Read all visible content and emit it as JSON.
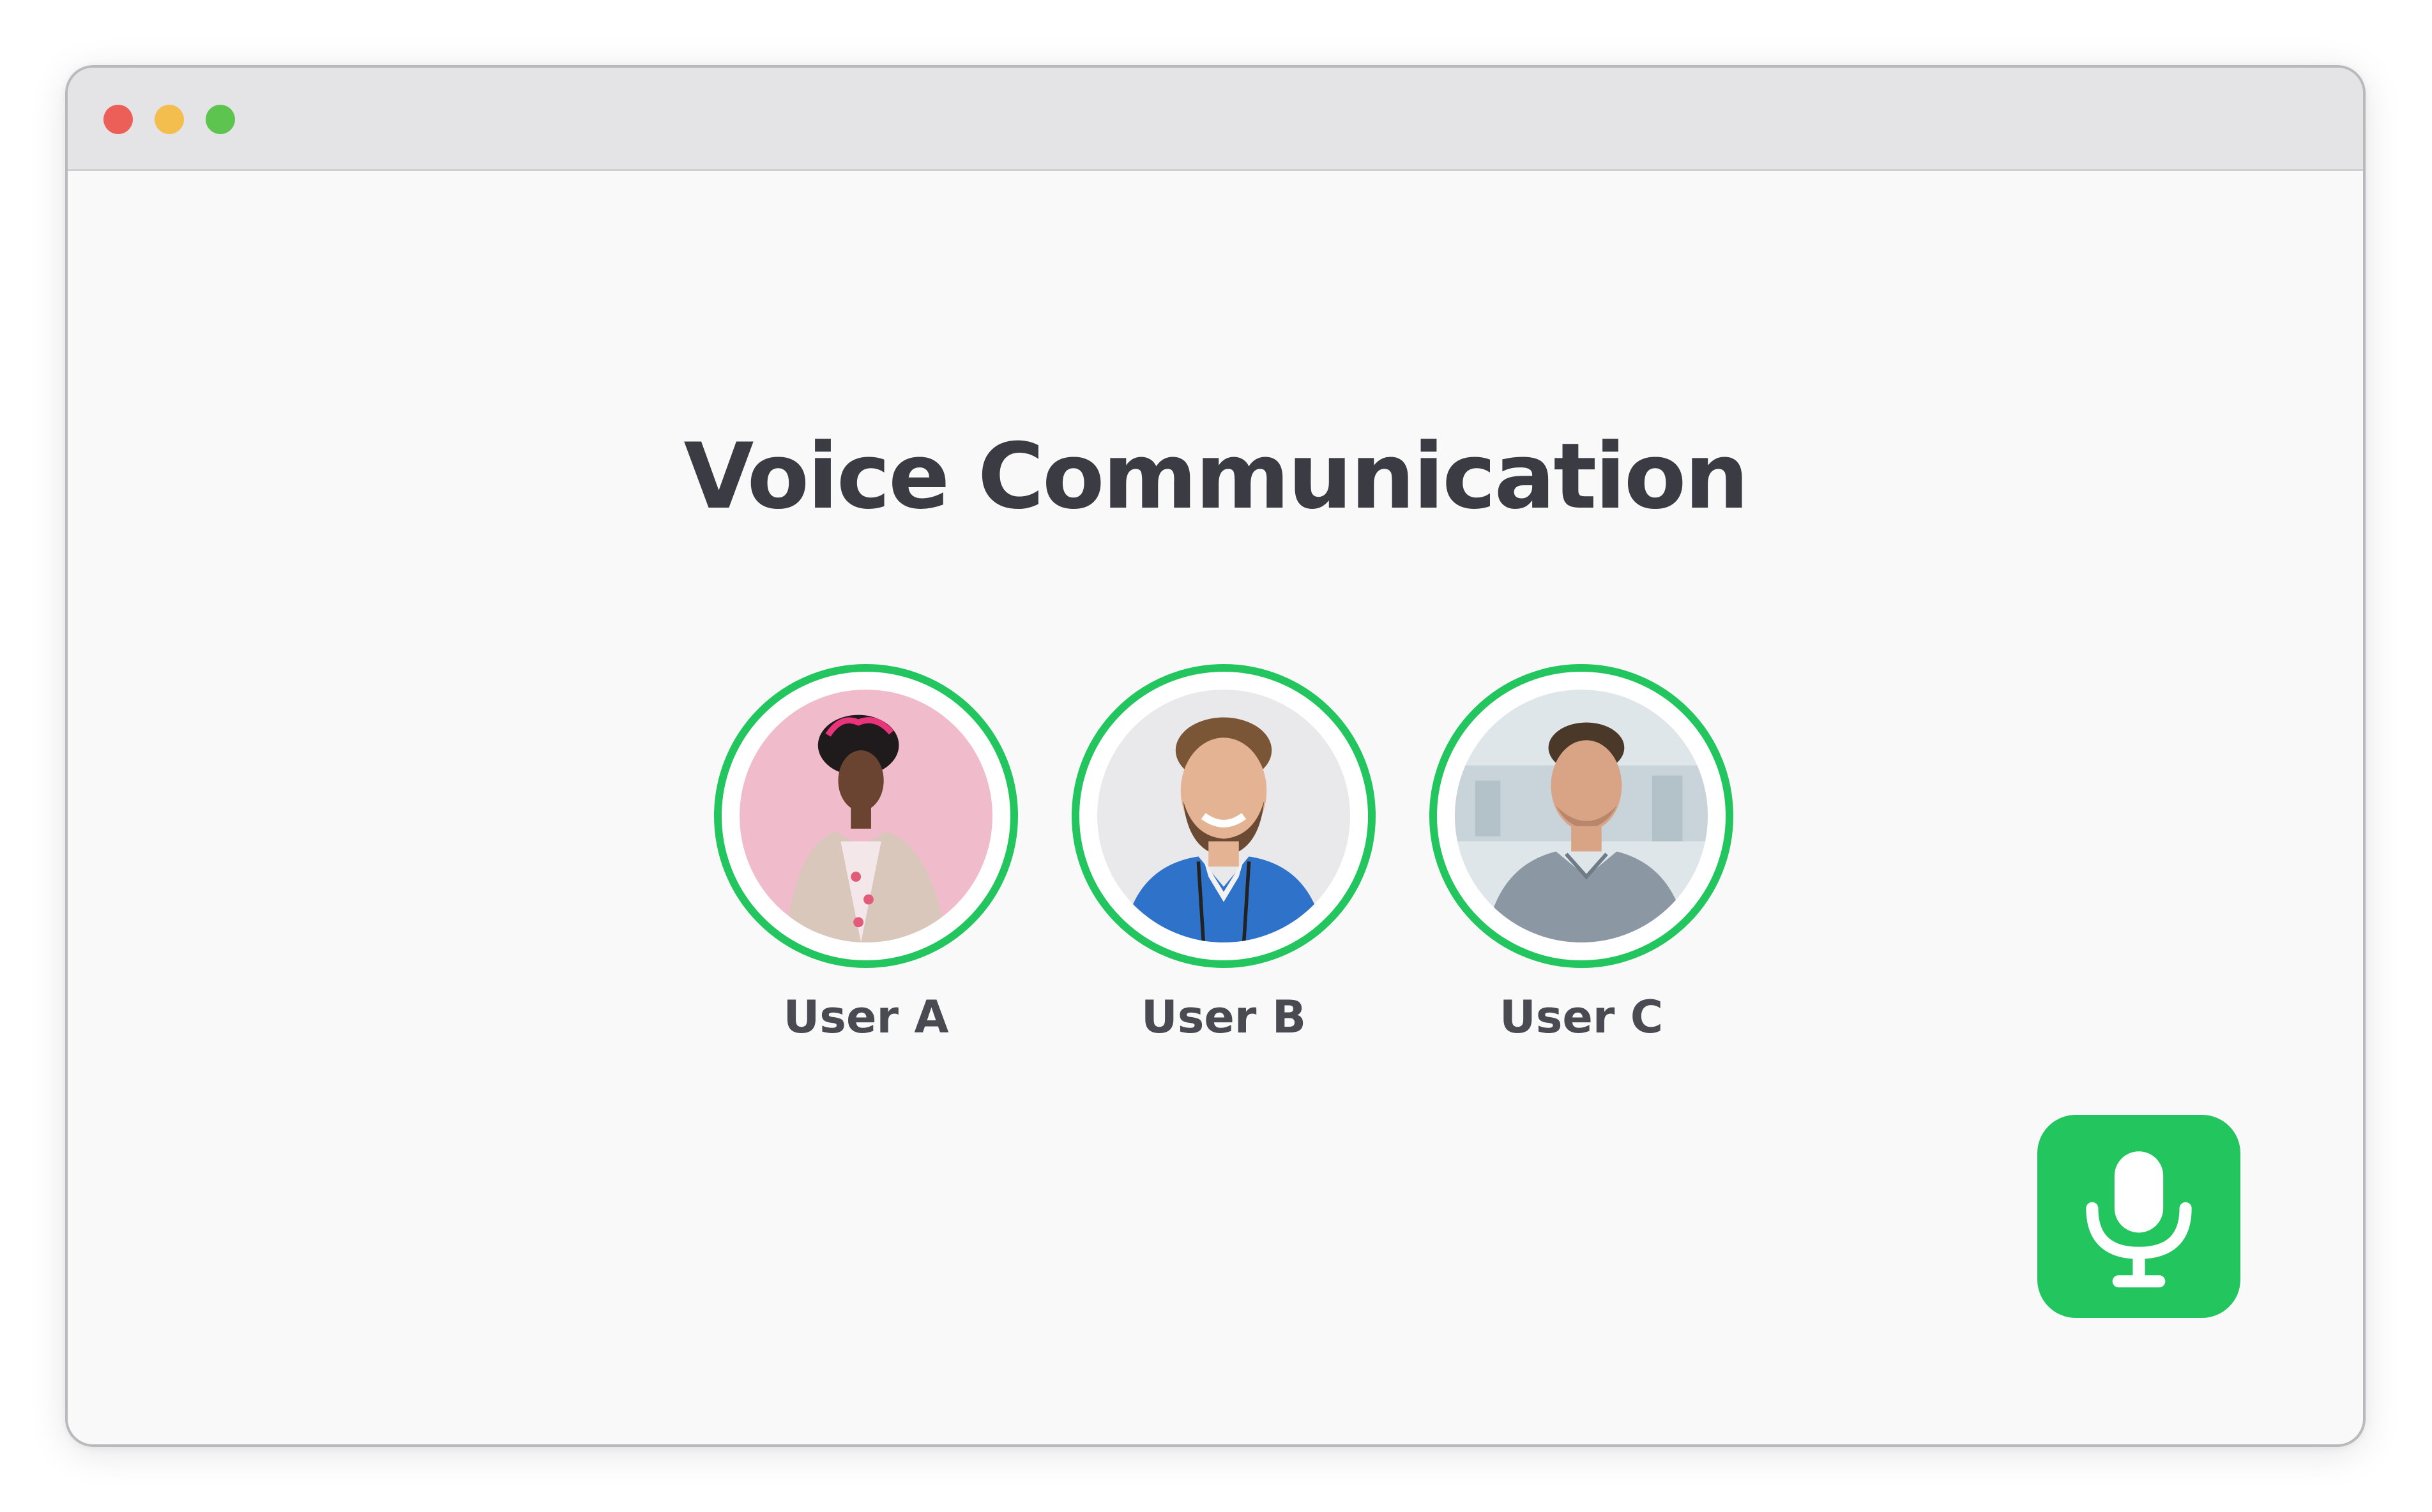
{
  "window": {
    "title": "Voice Communication"
  },
  "users": [
    {
      "label": "User A"
    },
    {
      "label": "User B"
    },
    {
      "label": "User C"
    }
  ],
  "controls": {
    "mic_icon": "microphone-icon",
    "mic_state_color": "#22c55e"
  },
  "colors": {
    "accent": "#22c55e",
    "title_text": "#3b3b44",
    "label_text": "#4a4a52"
  }
}
